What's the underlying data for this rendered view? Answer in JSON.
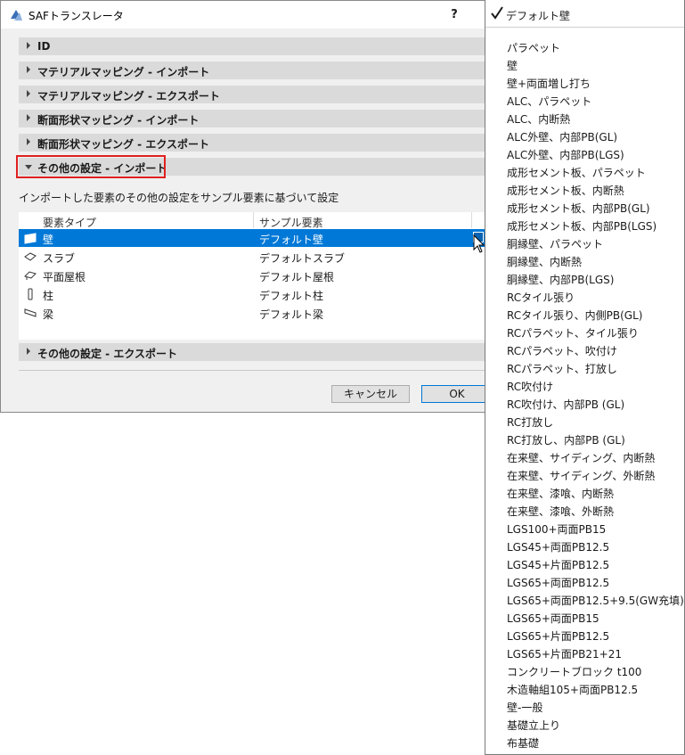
{
  "window": {
    "title": "SAFトランスレータ",
    "help": "?"
  },
  "sections": {
    "id": "ID",
    "material_import": "マテリアルマッピング - インポート",
    "material_export": "マテリアルマッピング - エクスポート",
    "profile_import": "断面形状マッピング - インポート",
    "profile_export": "断面形状マッピング - エクスポート",
    "other_import": "その他の設定 - インポート",
    "other_export": "その他の設定 - エクスポート"
  },
  "description": "インポートした要素のその他の設定をサンプル要素に基づいて設定",
  "table": {
    "headers": [
      "要素タイプ",
      "サンプル要素"
    ],
    "rows": [
      {
        "type": "壁",
        "sample": "デフォルト壁",
        "icon": "wall-icon",
        "selected": true
      },
      {
        "type": "スラブ",
        "sample": "デフォルトスラブ",
        "icon": "slab-icon",
        "selected": false
      },
      {
        "type": "平面屋根",
        "sample": "デフォルト屋根",
        "icon": "roof-icon",
        "selected": false
      },
      {
        "type": "柱",
        "sample": "デフォルト柱",
        "icon": "column-icon",
        "selected": false
      },
      {
        "type": "梁",
        "sample": "デフォルト梁",
        "icon": "beam-icon",
        "selected": false
      }
    ]
  },
  "buttons": {
    "cancel": "キャンセル",
    "ok": "OK"
  },
  "popup": {
    "current": "デフォルト壁",
    "items": [
      "パラペット",
      "壁",
      "壁+両面増し打ち",
      "ALC、パラペット",
      "ALC、内断熱",
      "ALC外壁、内部PB(GL)",
      "ALC外壁、内部PB(LGS)",
      "成形セメント板、パラペット",
      "成形セメント板、内断熱",
      "成形セメント板、内部PB(GL)",
      "成形セメント板、内部PB(LGS)",
      "胴縁壁、パラペット",
      "胴縁壁、内断熱",
      "胴縁壁、内部PB(LGS)",
      "RCタイル張り",
      "RCタイル張り、内側PB(GL)",
      "RCパラペット、タイル張り",
      "RCパラペット、吹付け",
      "RCパラペット、打放し",
      "RC吹付け",
      "RC吹付け、内部PB (GL)",
      "RC打放し",
      "RC打放し、内部PB (GL)",
      "在来壁、サイディング、内断熱",
      "在来壁、サイディング、外断熱",
      "在来壁、漆喰、内断熱",
      "在来壁、漆喰、外断熱",
      "LGS100+両面PB15",
      "LGS45+両面PB12.5",
      "LGS45+片面PB12.5",
      "LGS65+両面PB12.5",
      "LGS65+両面PB12.5+9.5(GW充填)",
      "LGS65+両面PB15",
      "LGS65+片面PB12.5",
      "LGS65+片面PB21+21",
      "コンクリートブロック t100",
      "木造軸組105+両面PB12.5",
      "壁-一般",
      "基礎立上り",
      "布基礎"
    ]
  },
  "colors": {
    "selection": "#0078d7",
    "highlight": "#e02020",
    "section_bg": "#dadada"
  }
}
